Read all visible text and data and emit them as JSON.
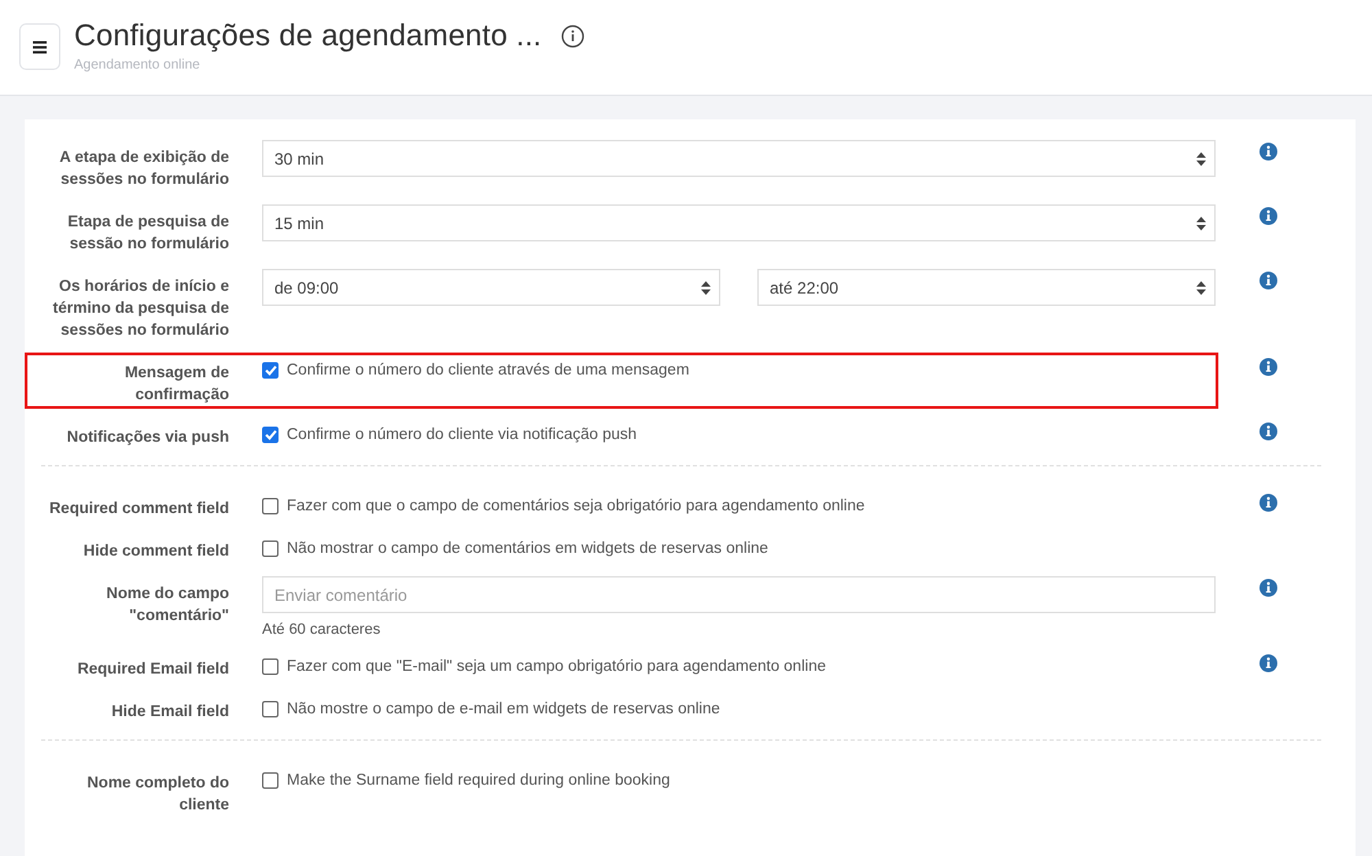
{
  "header": {
    "title": "Configurações de agendamento ...",
    "subtitle": "Agendamento online"
  },
  "sections": [
    {
      "rows": [
        {
          "kind": "select",
          "label": "A etapa de exibição de sessões no formulário",
          "value": "30 min",
          "info": true,
          "highlighted": false
        },
        {
          "kind": "select",
          "label": "Etapa de pesquisa de sessão no formulário",
          "value": "15 min",
          "info": true,
          "highlighted": false
        },
        {
          "kind": "select-pair",
          "label": "Os horários de início e término da pesquisa de sessões no formulário",
          "values": [
            "de 09:00",
            "até 22:00"
          ],
          "info": true,
          "highlighted": false
        },
        {
          "kind": "checkbox",
          "label": "Mensagem de confirmação",
          "text": "Confirme o número do cliente através de uma mensagem",
          "checked": true,
          "info": true,
          "highlighted": true
        },
        {
          "kind": "checkbox",
          "label": "Notificações via push",
          "text": "Confirme o número do cliente via notificação push",
          "checked": true,
          "info": true,
          "highlighted": false
        }
      ]
    },
    {
      "rows": [
        {
          "kind": "checkbox",
          "label": "Required comment field",
          "text": "Fazer com que o campo de comentários seja obrigatório para agendamento online",
          "checked": false,
          "info": true,
          "highlighted": false
        },
        {
          "kind": "checkbox",
          "label": "Hide comment field",
          "text": "Não mostrar o campo de comentários em widgets de reservas online",
          "checked": false,
          "info": false,
          "highlighted": false
        },
        {
          "kind": "text",
          "label": "Nome do campo \"comentário\"",
          "placeholder": "Enviar comentário",
          "hint": "Até 60 caracteres",
          "info": true,
          "highlighted": false
        },
        {
          "kind": "checkbox",
          "label": "Required Email field",
          "text": "Fazer com que \"E-mail\" seja um campo obrigatório para agendamento online",
          "checked": false,
          "info": true,
          "highlighted": false
        },
        {
          "kind": "checkbox",
          "label": "Hide Email field",
          "text": "Não mostre o campo de e-mail em widgets de reservas online",
          "checked": false,
          "info": false,
          "highlighted": false
        }
      ]
    },
    {
      "rows": [
        {
          "kind": "checkbox",
          "label": "Nome completo do cliente",
          "text": "Make the Surname field required during online booking",
          "checked": false,
          "info": false,
          "highlighted": false
        }
      ]
    }
  ]
}
